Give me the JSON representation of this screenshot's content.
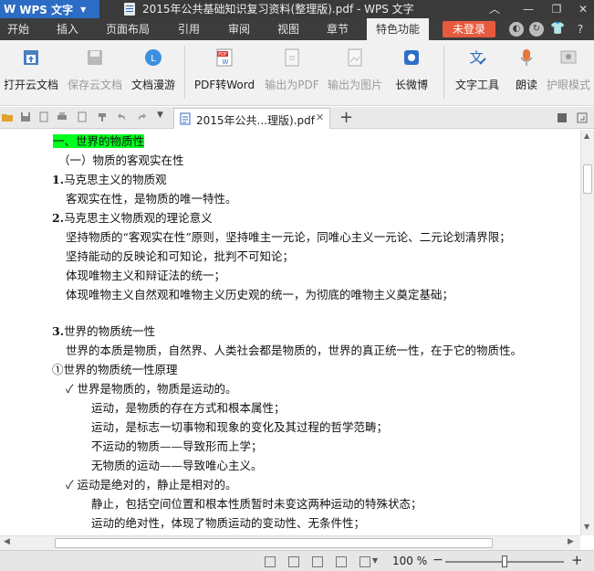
{
  "titlebar": {
    "app_logo": "W",
    "app_name": "WPS 文字",
    "doc_title": "2015年公共基础知识复习资料(整理版).pdf - WPS 文字"
  },
  "menu": {
    "tabs": [
      "开始",
      "插入",
      "页面布局",
      "引用",
      "审阅",
      "视图",
      "章节",
      "特色功能"
    ],
    "active_tab": "特色功能",
    "login_label": "未登录"
  },
  "ribbon": {
    "open_cloud": "打开云文档",
    "save_cloud": "保存云文档",
    "roam": "文档漫游",
    "pdf_to_word": "PDF转Word",
    "export_pdf": "输出为PDF",
    "export_image": "输出为图片",
    "long_weibo": "长微博",
    "text_tools": "文字工具",
    "read_aloud": "朗读",
    "eye_mode": "护眼模式"
  },
  "doc_tab": {
    "title": "2015年公共...理版).pdf"
  },
  "document": {
    "lines": [
      "一、世界的物质性",
      "（一）物质的客观实在性",
      "1.",
      "马克思主义的物质观",
      "客观实在性，是物质的唯一特性。",
      "2.",
      "马克思主义物质观的理论意义",
      "坚持物质的“客观实在性”原则，坚持唯主一元论，同唯心主义一元论、二元论划清界限；",
      "坚持能动的反映论和可知论，批判不可知论；",
      "体现唯物主义和辩证法的统一；",
      "体现唯物主义自然观和唯物主义历史观的统一，为彻底的唯物主义奠定基础；",
      "3.",
      "世界的物质统一性",
      "世界的本质是物质，自然界、人类社会都是物质的，世界的真正统一性，在于它的物质性。",
      "①世界的物质统一性原理",
      "✓ 世界是物质的，物质是运动的。",
      "运动，是物质的存在方式和根本属性；",
      "运动，是标志一切事物和现象的变化及其过程的哲学范畴；",
      "不运动的物质——导致形而上学；",
      "无物质的运动——导致唯心主义。",
      "✓ 运动是绝对的，静止是相对的。",
      "静止，包括空间位置和根本性质暂时未变这两种运动的特殊状态；",
      "运动的绝对性，体现了物质运动的变动性、无条件性；"
    ]
  },
  "status": {
    "zoom": "100 %",
    "zoom_fraction": 0.5
  }
}
